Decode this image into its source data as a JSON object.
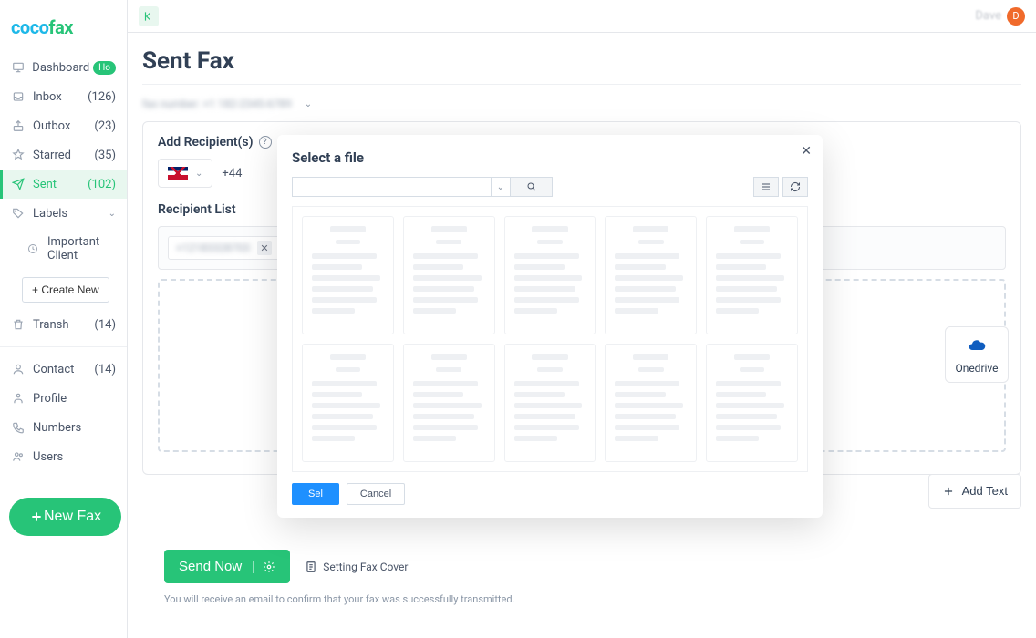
{
  "brand": {
    "part1": "coco",
    "part2": "fax"
  },
  "user": {
    "name": "Dave",
    "initial": "D"
  },
  "sidebar": {
    "items": [
      {
        "label": "Dashboard",
        "count": "",
        "badge": "Ho"
      },
      {
        "label": "Inbox",
        "count": "(126)"
      },
      {
        "label": "Outbox",
        "count": "(23)"
      },
      {
        "label": "Starred",
        "count": "(35)"
      },
      {
        "label": "Sent",
        "count": "(102)"
      },
      {
        "label": "Labels",
        "count": ""
      },
      {
        "label": "Important Client",
        "count": ""
      },
      {
        "label": "Transh",
        "count": "(14)"
      },
      {
        "label": "Contact",
        "count": "(14)"
      },
      {
        "label": "Profile",
        "count": ""
      },
      {
        "label": "Numbers",
        "count": ""
      },
      {
        "label": "Users",
        "count": ""
      }
    ],
    "create_new": "+ Create New",
    "new_fax": "New Fax"
  },
  "page": {
    "title": "Sent Fax",
    "fax_number_label": "fax number: +1 182-2345-6789",
    "add_recipients": "Add Recipient(s)",
    "dial_code": "+44",
    "recipient_list": "Recipient List",
    "chip_number": "+12183328703",
    "onedrive": "Onedrive",
    "add_text": "Add Text",
    "send_now": "Send Now",
    "setting_cover": "Setting Fax Cover",
    "confirm_note": "You will receive an email to confirm that your fax was successfully transmitted."
  },
  "modal": {
    "title": "Select a file",
    "select_label": "Sel",
    "cancel_label": "Cancel"
  }
}
